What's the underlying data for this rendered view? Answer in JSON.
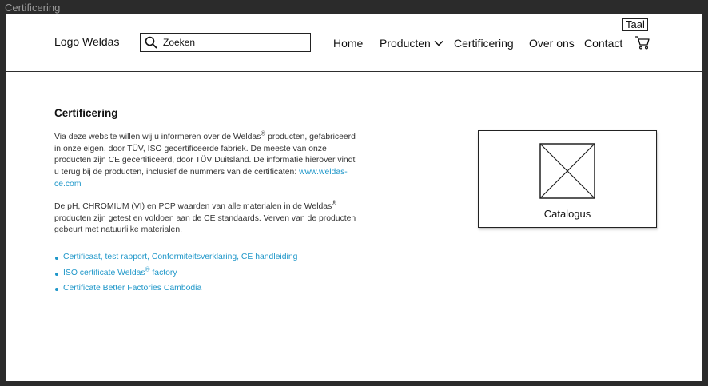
{
  "window": {
    "title": "Certificering"
  },
  "header": {
    "logo": "Logo Weldas",
    "search_placeholder": "Zoeken",
    "nav": {
      "home": "Home",
      "producten": "Producten",
      "certificering": "Certificering",
      "over_ons": "Over ons",
      "contact": "Contact"
    },
    "language": "Taal"
  },
  "main": {
    "heading": "Certificering",
    "paragraph1": {
      "part1": "Via deze website willen wij u informeren over de Weldas",
      "reg": "®",
      "part2": " producten, gefabriceerd in onze eigen, door TÜV, ISO gecertificeerde fabriek. De meeste van onze producten zijn CE gecertificeerd, door TÜV Duitsland. De informatie hierover vindt u terug bij de producten, inclusief de nummers van de certificaten: ",
      "link": "www.weldas-ce.com"
    },
    "paragraph2": {
      "part1": "De pH, CHROMIUM (VI) en PCP waarden van alle materialen in de Weldas",
      "reg": "®",
      "part2": " producten zijn getest en voldoen aan de CE standaards. Verven van de producten gebeurt met natuurlijke materialen."
    },
    "links": {
      "link1": "Certificaat, test rapport, Conformiteitsverklaring, CE handleiding",
      "link2_part1": "ISO certificate Weldas",
      "link2_reg": "®",
      "link2_part2": " factory",
      "link3": "Certificate Better Factories Cambodia"
    },
    "catalog": {
      "caption": "Catalogus"
    }
  },
  "colors": {
    "link": "#1f97c9",
    "border": "#222222"
  }
}
